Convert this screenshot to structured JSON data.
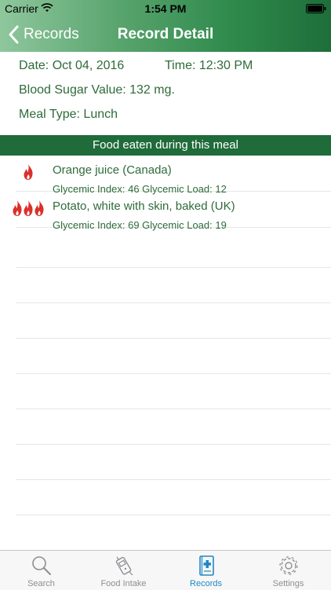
{
  "status_bar": {
    "carrier": "Carrier",
    "time": "1:54 PM"
  },
  "nav": {
    "back_label": "Records",
    "title": "Record Detail"
  },
  "record": {
    "date": "Date: Oct 04, 2016",
    "time": "Time: 12:30 PM",
    "blood_sugar": "Blood Sugar Value: 132 mg.",
    "meal_type": "Meal Type: Lunch"
  },
  "section_title": "Food eaten during this meal",
  "foods": [
    {
      "name": "Orange juice (Canada)",
      "gi_text": "Glycemic Index: 46 Glycemic Load: 12",
      "flame_count": 1
    },
    {
      "name": "Potato, white with skin, baked (UK)",
      "gi_text": "Glycemic Index: 69 Glycemic Load: 19",
      "flame_count": 3
    }
  ],
  "tabs": [
    {
      "label": "Search",
      "icon": "search-icon",
      "active": false
    },
    {
      "label": "Food Intake",
      "icon": "food-intake-icon",
      "active": false
    },
    {
      "label": "Records",
      "icon": "records-icon",
      "active": true
    },
    {
      "label": "Settings",
      "icon": "gear-icon",
      "active": false
    }
  ],
  "colors": {
    "header_dark": "#1e6e3a",
    "header_light": "#8fc79d",
    "text_green": "#2e6b3a",
    "section_bar": "#1f6b3a",
    "flame": "#d9312b",
    "tab_active": "#1e88c8"
  }
}
